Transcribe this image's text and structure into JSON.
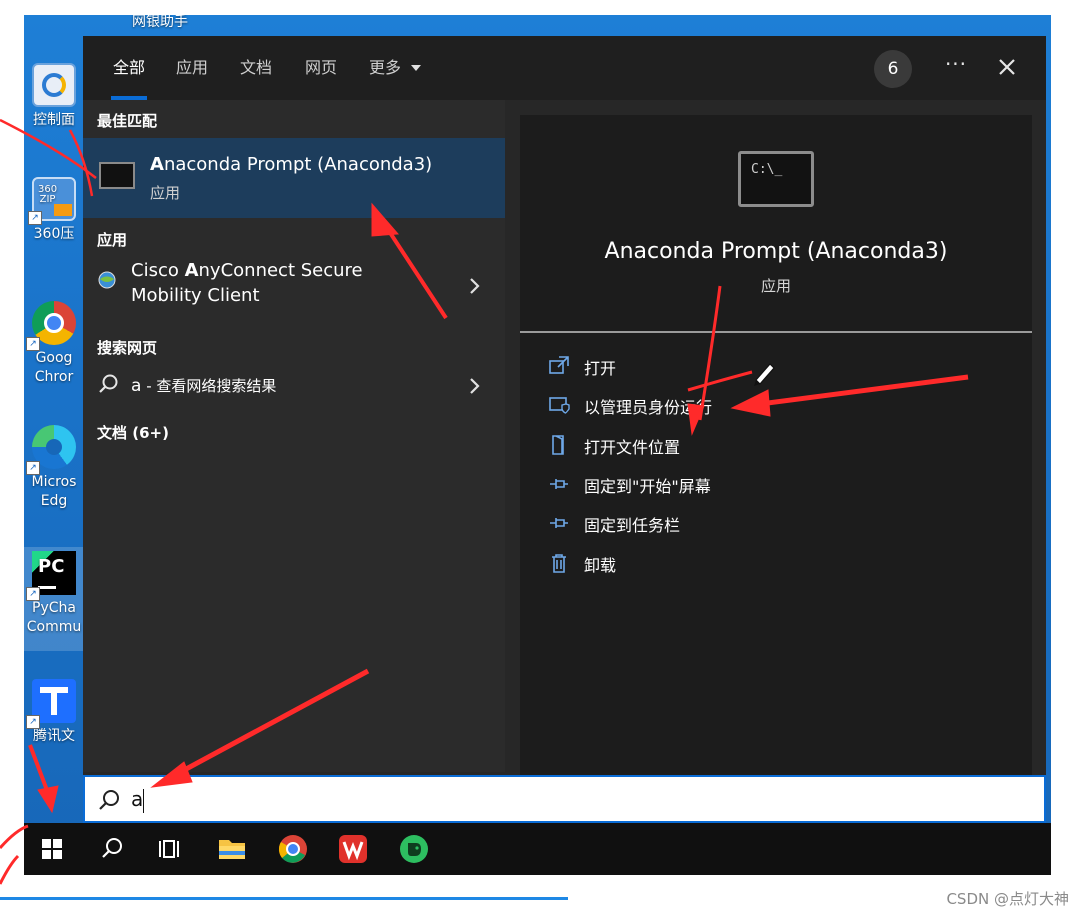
{
  "desktop": {
    "top_label": "网银助手",
    "icons": [
      {
        "label_lines": [
          "控制面"
        ],
        "name": "control-panel"
      },
      {
        "label_lines": [
          "360压"
        ],
        "name": "360zip"
      },
      {
        "label_lines": [
          "Goog",
          "Chror"
        ],
        "name": "chrome"
      },
      {
        "label_lines": [
          "Micros",
          "Edg"
        ],
        "name": "edge"
      },
      {
        "label_lines": [
          "PyCha",
          "Commu"
        ],
        "name": "pycharm"
      },
      {
        "label_lines": [
          "腾讯文"
        ],
        "name": "tencent-docs"
      }
    ],
    "icon_360_text": "360\nZIP",
    "icon_pycharm_text": "PC"
  },
  "panel": {
    "tabs": [
      "全部",
      "应用",
      "文档",
      "网页",
      "更多"
    ],
    "active_tab": "全部",
    "count_badge": "6",
    "more_glyph": "···",
    "best_match_header": "最佳匹配",
    "best_match": {
      "name": "Anaconda Prompt (Anaconda3)",
      "type": "应用"
    },
    "apps_header": "应用",
    "apps": [
      {
        "line1": "Cisco AnyConnect Secure",
        "line2": "Mobility Client"
      }
    ],
    "web_header": "搜索网页",
    "web_result": {
      "query": "a",
      "suffix": " - 查看网络搜索结果"
    },
    "docs_header": "文档 (6+)"
  },
  "preview": {
    "icon_text": "C:\\_",
    "title": "Anaconda Prompt (Anaconda3)",
    "subtitle": "应用",
    "actions": [
      {
        "label": "打开",
        "icon": "open-icon"
      },
      {
        "label": "以管理员身份运行",
        "icon": "shield-icon"
      },
      {
        "label": "打开文件位置",
        "icon": "file-location-icon"
      },
      {
        "label": "固定到\"开始\"屏幕",
        "icon": "pin-icon"
      },
      {
        "label": "固定到任务栏",
        "icon": "pin-icon"
      },
      {
        "label": "卸载",
        "icon": "trash-icon"
      }
    ]
  },
  "search": {
    "value": "a"
  },
  "taskbar": {
    "items": [
      "windows-start-icon",
      "search-icon",
      "task-view-icon",
      "file-explorer-icon",
      "chrome-icon",
      "wps-icon",
      "evernote-icon"
    ]
  },
  "watermark": "CSDN @点灯大神",
  "colors": {
    "accent": "#0a6cd6",
    "selected": "#1d3d5c",
    "annotation": "#ff2a2a"
  }
}
